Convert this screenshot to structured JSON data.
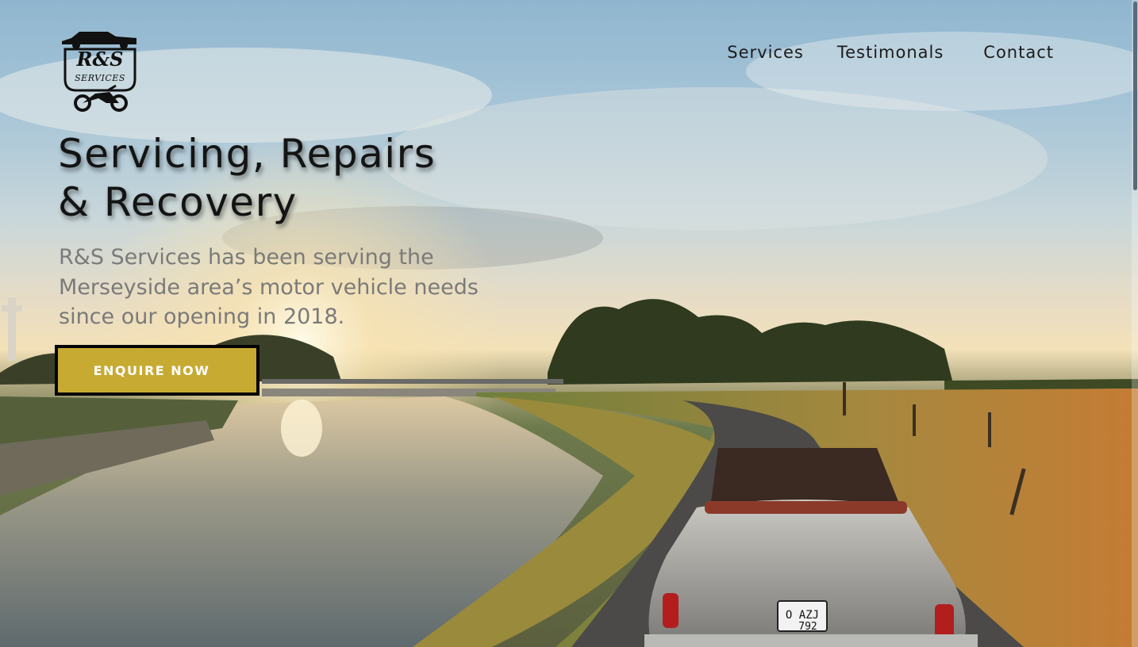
{
  "brand": {
    "logo_text_main": "R&S",
    "logo_text_sub": "SERVICES"
  },
  "nav": {
    "items": [
      {
        "label": "Services"
      },
      {
        "label": "Testimonals"
      },
      {
        "label": "Contact"
      }
    ]
  },
  "hero": {
    "headline_line1": "Servicing, Repairs",
    "headline_line2": "& Recovery",
    "description": "R&S Services has been serving the Merseyside area’s motor vehicle needs since our opening in 2018.",
    "cta_label": "ENQUIRE NOW",
    "background_image_plate": "O AZJ 792"
  },
  "colors": {
    "accent_gold": "#c7aa32",
    "text_dark": "#141414",
    "text_muted": "#7a7a7a"
  }
}
